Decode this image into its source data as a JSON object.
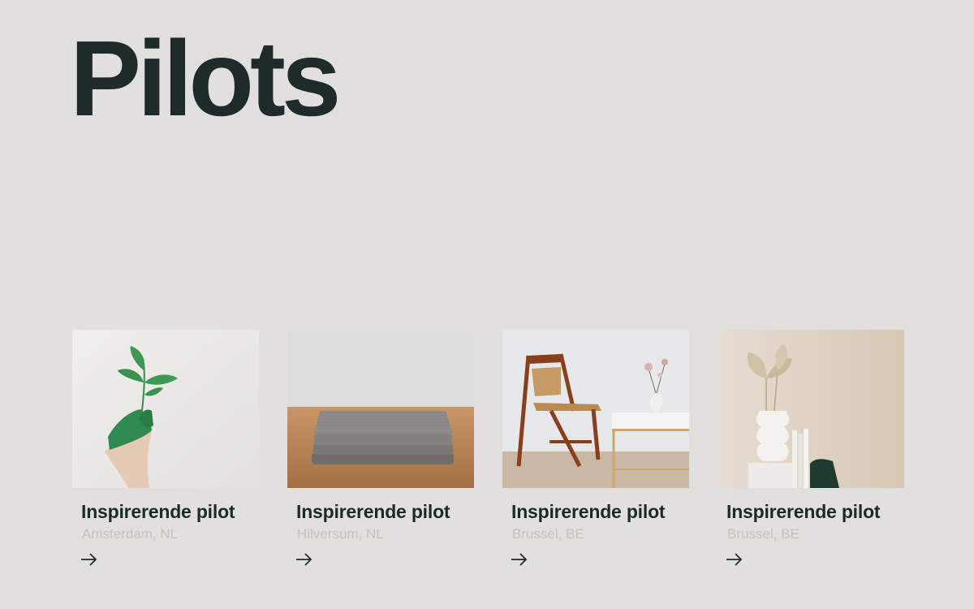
{
  "header": {
    "title": "Pilots"
  },
  "cards": [
    {
      "title": "Inspirerende pilot",
      "location": "Amsterdam, NL",
      "image": "hand-holding-plant",
      "arrow_icon": "arrow-right-icon"
    },
    {
      "title": "Inspirerende pilot",
      "location": "Hilversum, NL",
      "image": "stacked-grey-blankets",
      "arrow_icon": "arrow-right-icon"
    },
    {
      "title": "Inspirerende pilot",
      "location": "Brussel, BE",
      "image": "wooden-folding-chair",
      "arrow_icon": "arrow-right-icon"
    },
    {
      "title": "Inspirerende pilot",
      "location": "Brussel, BE",
      "image": "white-vase-dried-palm-leaves",
      "arrow_icon": "arrow-right-icon"
    }
  ],
  "colors": {
    "background": "#e2e0de",
    "title": "#1f2b2b",
    "location": "#c7bfb8"
  }
}
